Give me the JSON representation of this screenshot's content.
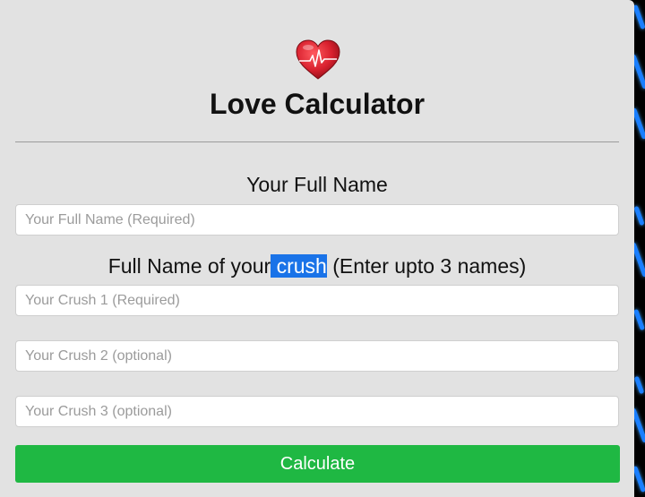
{
  "app": {
    "title": "Love Calculator",
    "logo_icon": "heart-pulse-icon"
  },
  "form": {
    "name_label": "Your Full Name",
    "name_placeholder": "Your Full Name (Required)",
    "crush_label_prefix": "Full Name of your",
    "crush_label_highlight": " crush",
    "crush_label_suffix": " (Enter upto 3 names)",
    "crush1_placeholder": "Your Crush 1 (Required)",
    "crush2_placeholder": "Your Crush 2 (optional)",
    "crush3_placeholder": "Your Crush 3 (optional)",
    "submit_label": "Calculate"
  },
  "colors": {
    "background": "#e2e2e2",
    "button": "#1fb843",
    "heart": "#d8202e",
    "selection": "#1a73e8"
  }
}
